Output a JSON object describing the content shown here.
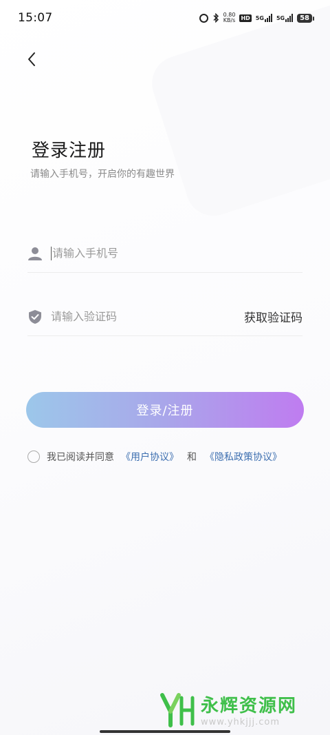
{
  "status_bar": {
    "time": "15:07",
    "speed_value": "0.80",
    "speed_unit": "KB/s",
    "hd_label": "HD",
    "signal_1": "5G",
    "signal_2": "5G",
    "battery": "58"
  },
  "header": {
    "title": "登录注册",
    "subtitle": "请输入手机号，开启你的有趣世界"
  },
  "form": {
    "phone_placeholder": "请输入手机号",
    "code_placeholder": "请输入验证码",
    "get_code_label": "获取验证码",
    "submit_label": "登录/注册"
  },
  "agreement": {
    "prefix": "我已阅读并同意",
    "user_agreement": "《用户协议》",
    "and": "和",
    "privacy_policy": "《隐私政策协议》"
  },
  "watermark": {
    "name": "永辉资源网",
    "url": "www.yhkjjj.com"
  },
  "colors": {
    "button_gradient_start": "#9cc7ea",
    "button_gradient_end": "#bf7cf0",
    "link": "#3d6fb0",
    "watermark_green": "#3fbf4a"
  }
}
